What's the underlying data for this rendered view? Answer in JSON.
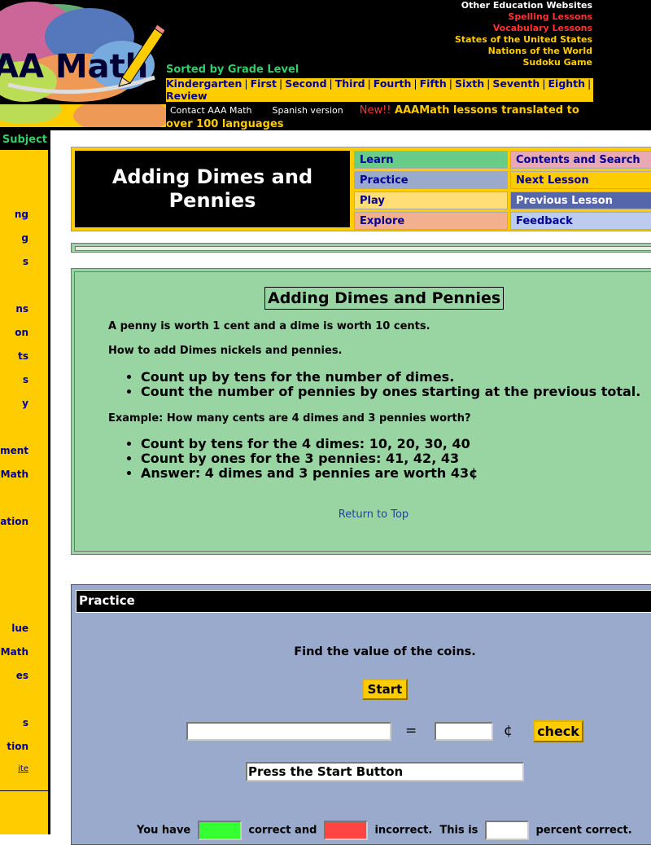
{
  "header": {
    "logo_text": "AA Math",
    "other_sites": {
      "title": "Other Education Websites",
      "links": [
        {
          "label": "Spelling Lessons",
          "color": "#ff3333"
        },
        {
          "label": "Vocabulary Lessons",
          "color": "#ff3333"
        },
        {
          "label": "States of the United States",
          "color": "#ffcc00"
        },
        {
          "label": "Nations of the World",
          "color": "#ffcc00"
        },
        {
          "label": "Sudoku Game",
          "color": "#ffcc00"
        }
      ]
    },
    "grade_title": "Sorted by Grade Level",
    "grades": [
      "Kindergarten",
      "First",
      "Second",
      "Third",
      "Fourth",
      "Fifth",
      "Sixth",
      "Seventh",
      "Eighth"
    ],
    "review": "Review",
    "contact": "Contact AAA Math",
    "spanish": "Spanish version",
    "new_label": "New!!",
    "news": "AAAMath lessons translated to over 100 languages"
  },
  "sidebar": {
    "title": "Subject",
    "items": [
      {
        "label": "ng",
        "tiny": false
      },
      {
        "label": "g",
        "tiny": false
      },
      {
        "label": "s",
        "tiny": false
      },
      {
        "label": "ns",
        "tiny": false
      },
      {
        "label": "on",
        "tiny": false
      },
      {
        "label": "ts",
        "tiny": false
      },
      {
        "label": "s",
        "tiny": false
      },
      {
        "label": "y",
        "tiny": false
      },
      {
        "label": "ment",
        "tiny": false
      },
      {
        "label": "Math",
        "tiny": false
      },
      {
        "label": "ation",
        "tiny": false
      },
      {
        "label": "lue",
        "tiny": false
      },
      {
        "label": "l Math",
        "tiny": false
      },
      {
        "label": "es",
        "tiny": false
      },
      {
        "label": "s",
        "tiny": false
      },
      {
        "label": "tion",
        "tiny": false
      },
      {
        "label": "ite",
        "tiny": true
      }
    ]
  },
  "lesson": {
    "title": "Adding Dimes and Pennies",
    "nav": {
      "learn": "Learn",
      "practice": "Practice",
      "play": "Play",
      "explore": "Explore",
      "contents": "Contents and Search",
      "next": "Next Lesson",
      "previous": "Previous Lesson",
      "feedback": "Feedback"
    }
  },
  "learn": {
    "heading": "Adding Dimes and Pennies",
    "intro": "A penny is worth 1 cent and a dime is worth 10 cents.",
    "how_to": "How to add Dimes nickels and pennies.",
    "steps": [
      "Count up by tens for the number of dimes.",
      "Count the number of pennies by ones starting at the previous total."
    ],
    "example": "Example: How many cents are 4 dimes and 3 pennies worth?",
    "example_steps": [
      "Count by tens for the 4 dimes: 10, 20, 30, 40",
      "Count by ones for the 3 pennies: 41, 42, 43",
      "Answer: 4 dimes and 3 pennies are worth 43¢"
    ],
    "return_top": "Return to Top"
  },
  "practice": {
    "heading": "Practice",
    "prompt": "Find the value of the coins.",
    "start_label": "Start",
    "expression_value": "",
    "equals": "=",
    "answer_value": "",
    "cent_sign": "¢",
    "check_label": "check",
    "status": "Press the Start Button",
    "score": {
      "you_have": "You have",
      "correct_and": "correct and",
      "incorrect": "incorrect.",
      "this_is": "This is",
      "percent_correct": "percent correct.",
      "correct_value": "",
      "incorrect_value": "",
      "percent_value": ""
    }
  }
}
